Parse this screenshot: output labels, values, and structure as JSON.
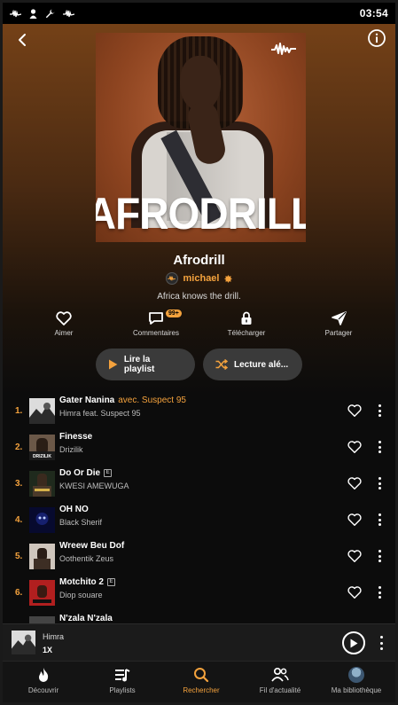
{
  "status_bar": {
    "time": "03:54",
    "icons": [
      "audiomack-icon",
      "person-icon",
      "wrench-icon",
      "audiomack-icon"
    ]
  },
  "header": {
    "back_icon": "chevron-left-icon",
    "info_icon": "info-icon"
  },
  "cover": {
    "title_text": "AFRODRILL",
    "logo": "audiomack-logo",
    "background_color": "#a8542a"
  },
  "playlist": {
    "title": "Afrodrill",
    "owner": "michael",
    "description": "Africa knows the drill."
  },
  "actions": {
    "like": "Aimer",
    "comments": "Commentaires",
    "comments_badge": "99+",
    "download": "Télécharger",
    "share": "Partager"
  },
  "buttons": {
    "play": "Lire la playlist",
    "shuffle": "Lecture alé..."
  },
  "tracks": [
    {
      "num": "1.",
      "title": "Gater Nanina",
      "feat": "avec. Suspect 95",
      "artist": "Himra feat. Suspect 95",
      "explicit": false,
      "thumb_color": "#d9d9d9"
    },
    {
      "num": "2.",
      "title": "Finesse",
      "feat": "",
      "artist": "Drizilik",
      "explicit": false,
      "thumb_color": "#5a4a3c"
    },
    {
      "num": "3.",
      "title": "Do Or Die",
      "feat": "",
      "artist": "KWESI AMEWUGA",
      "explicit": true,
      "thumb_color": "#2f3a2a"
    },
    {
      "num": "4.",
      "title": "OH NO",
      "feat": "",
      "artist": "Black Sherif",
      "explicit": false,
      "thumb_color": "#0b0f3a"
    },
    {
      "num": "5.",
      "title": "Wreew Beu Dof",
      "feat": "",
      "artist": "Oothentik Zeus",
      "explicit": false,
      "thumb_color": "#c9c0b8"
    },
    {
      "num": "6.",
      "title": "Motchito 2",
      "feat": "",
      "artist": "Diop souare",
      "explicit": true,
      "thumb_color": "#b11f1f"
    },
    {
      "num": "7.",
      "title": "N'zala N'zala",
      "feat": "",
      "artist": "",
      "explicit": false,
      "thumb_color": "#444444"
    }
  ],
  "mini_player": {
    "artist": "Himra",
    "rate": "1X"
  },
  "bottom_nav": [
    {
      "label": "Découvrir",
      "icon": "flame-icon",
      "active": false
    },
    {
      "label": "Playlists",
      "icon": "playlist-icon",
      "active": false
    },
    {
      "label": "Rechercher",
      "icon": "search-icon",
      "active": true
    },
    {
      "label": "Fil d'actualité",
      "icon": "people-icon",
      "active": false
    },
    {
      "label": "Ma bibliothèque",
      "icon": "avatar-icon",
      "active": false
    }
  ],
  "colors": {
    "accent": "#f4a23d",
    "background": "#0c0c0c",
    "pill": "#3a3a3a"
  }
}
